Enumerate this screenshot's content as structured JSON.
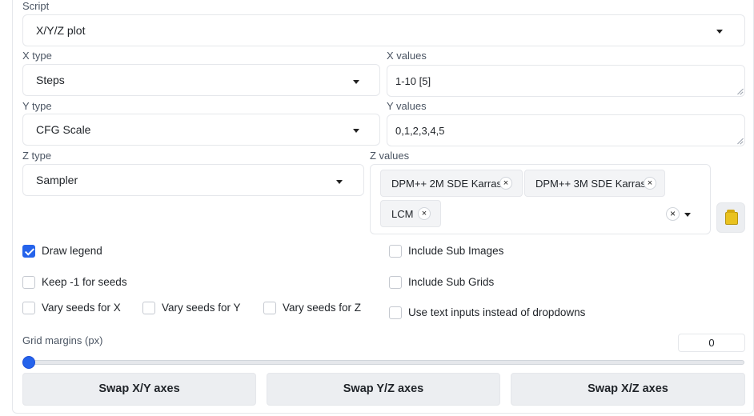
{
  "script": {
    "label": "Script",
    "value": "X/Y/Z plot"
  },
  "x": {
    "type_label": "X type",
    "type_value": "Steps",
    "values_label": "X values",
    "values_value": "1-10 [5]"
  },
  "y": {
    "type_label": "Y type",
    "type_value": "CFG Scale",
    "values_label": "Y values",
    "values_value": "0,1,2,3,4,5"
  },
  "z": {
    "type_label": "Z type",
    "type_value": "Sampler",
    "values_label": "Z values",
    "chips": [
      "DPM++ 2M SDE Karras",
      "DPM++ 3M SDE Karras",
      "LCM"
    ],
    "chip_remove": "×",
    "clear_symbol": "×"
  },
  "options": {
    "draw_legend": {
      "label": "Draw legend",
      "checked": true
    },
    "keep_seeds": {
      "label": "Keep -1 for seeds",
      "checked": false
    },
    "vary_x": {
      "label": "Vary seeds for X",
      "checked": false
    },
    "vary_y": {
      "label": "Vary seeds for Y",
      "checked": false
    },
    "vary_z": {
      "label": "Vary seeds for Z",
      "checked": false
    },
    "include_sub_images": {
      "label": "Include Sub Images",
      "checked": false
    },
    "include_sub_grids": {
      "label": "Include Sub Grids",
      "checked": false
    },
    "use_text_inputs": {
      "label": "Use text inputs instead of dropdowns",
      "checked": false
    }
  },
  "grid_margins": {
    "label": "Grid margins (px)",
    "value": "0",
    "slider_fraction": 0
  },
  "buttons": {
    "swap_xy": "Swap X/Y axes",
    "swap_yz": "Swap Y/Z axes",
    "swap_xz": "Swap X/Z axes"
  },
  "icons": {
    "folder": "folder-icon",
    "caret": "caret-down-icon",
    "close": "close-icon"
  },
  "colors": {
    "accent": "#2563eb",
    "button_bg": "#eceef1",
    "border": "#e5e7eb"
  }
}
